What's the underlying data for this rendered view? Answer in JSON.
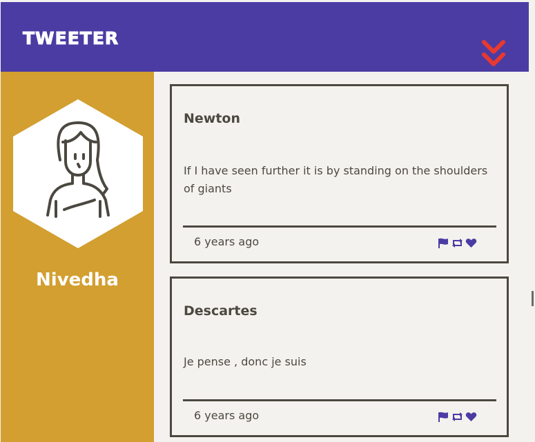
{
  "app": {
    "title": "TWEETER"
  },
  "colors": {
    "header": "#4b3ca4",
    "sidebar": "#d29f30",
    "accent_red": "#e8392f",
    "icon_purple": "#4b3ca4",
    "text_dark": "#4b4840"
  },
  "header": {
    "menu_icon": "double-chevron-down-icon"
  },
  "profile": {
    "name": "Nivedha",
    "avatar_icon": "woman-avatar-icon"
  },
  "tweets": [
    {
      "author": "Newton",
      "text": "If I have seen further it is by standing on the shoulders of giants",
      "time": "6 years ago",
      "actions": [
        "flag-icon",
        "retweet-icon",
        "heart-icon"
      ]
    },
    {
      "author": "Descartes",
      "text": "Je pense , donc je suis",
      "time": "6 years ago",
      "actions": [
        "flag-icon",
        "retweet-icon",
        "heart-icon"
      ]
    }
  ]
}
